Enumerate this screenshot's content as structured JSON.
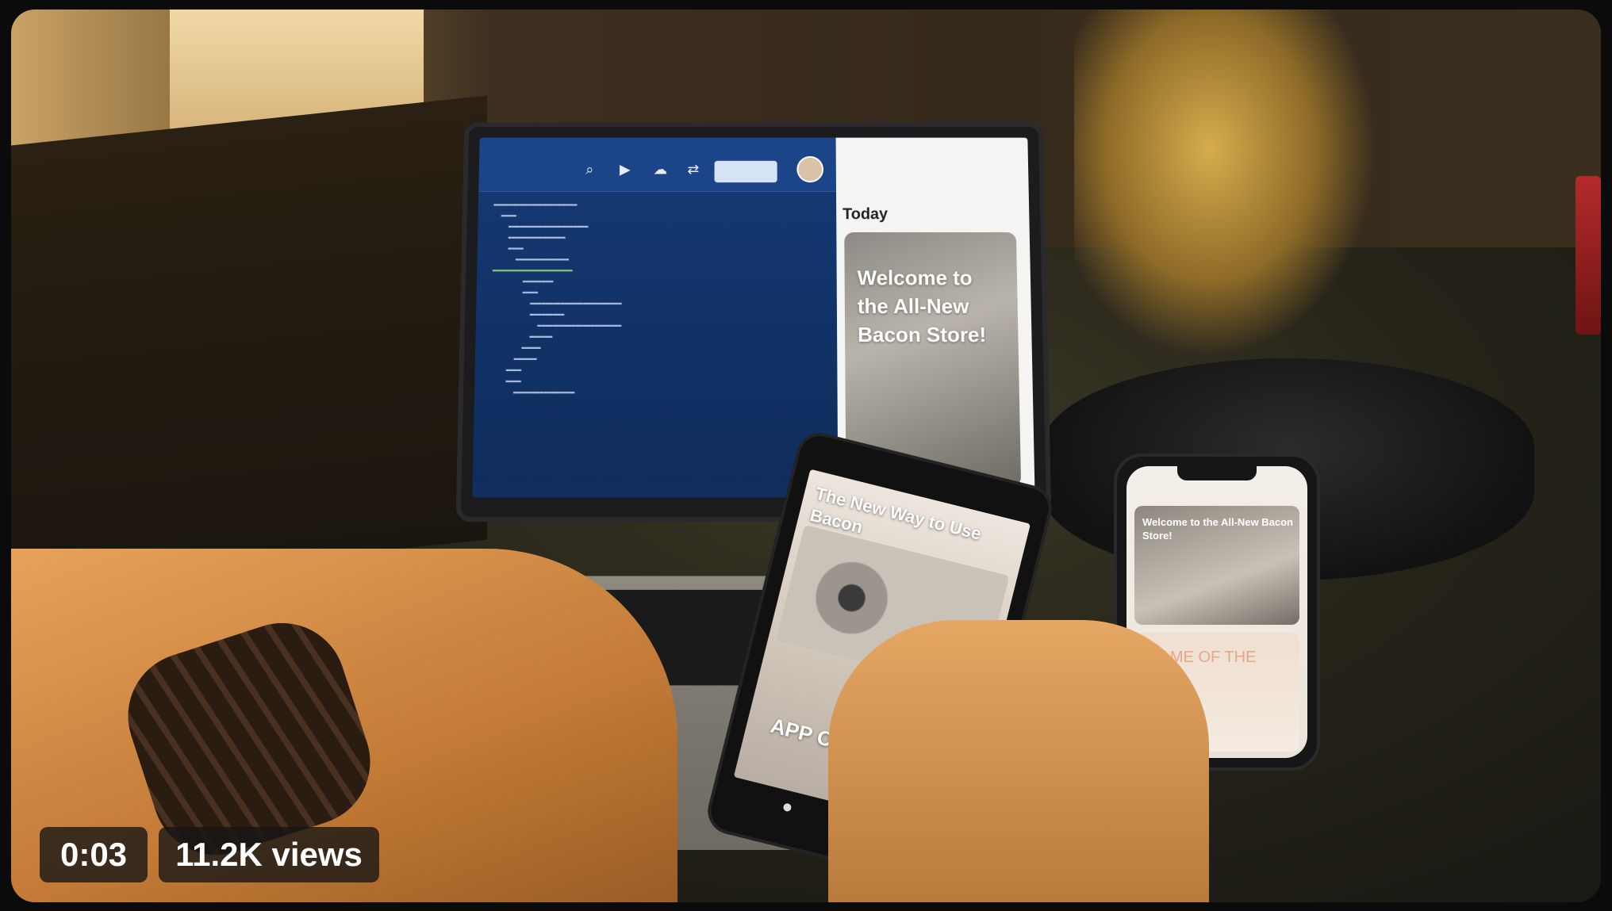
{
  "video": {
    "timestamp": "0:03",
    "views_label": "11.2K views"
  },
  "laptop_screen": {
    "preview_title": "Today",
    "preview_card_title": "Welcome to the All-New Bacon Store!"
  },
  "android_phone": {
    "card_title": "The New Way to Use Bacon",
    "card2_title": "APP OF THE DAY"
  },
  "iphone": {
    "card_title": "Welcome to the All-New Bacon Store!",
    "card2_title": "GAME OF THE DAY"
  }
}
